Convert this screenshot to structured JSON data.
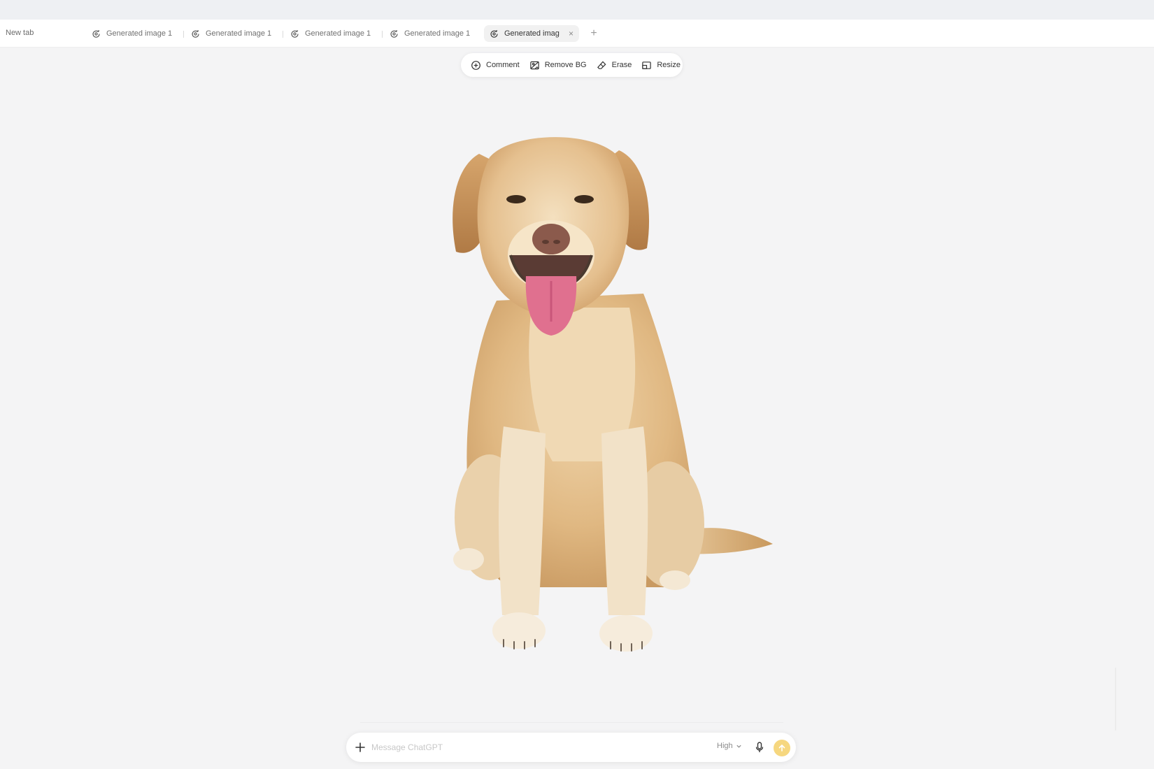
{
  "tabs": {
    "new_tab_label": "New tab",
    "items": [
      {
        "label": "Generated image 1",
        "icon": "generated-image-icon"
      },
      {
        "label": "Generated image 1",
        "icon": "generated-image-icon"
      },
      {
        "label": "Generated image 1",
        "icon": "generated-image-icon"
      },
      {
        "label": "Generated image 1",
        "icon": "generated-image-icon"
      },
      {
        "label": "Generated imag",
        "icon": "generated-image-icon",
        "active": true
      }
    ],
    "close_glyph": "×",
    "add_glyph": "+"
  },
  "toolbar": {
    "comment": {
      "label": "Comment",
      "icon": "comment-plus-icon"
    },
    "remove_bg": {
      "label": "Remove BG",
      "icon": "remove-bg-icon"
    },
    "erase": {
      "label": "Erase",
      "icon": "eraser-icon"
    },
    "resize": {
      "label": "Resize",
      "icon": "resize-icon"
    }
  },
  "canvas": {
    "image_subject": "Labrador retriever sitting, background removed",
    "background_color": "#f4f4f5"
  },
  "composer": {
    "placeholder": "Message ChatGPT",
    "quality_label": "High",
    "send_color": "#f6d77f"
  }
}
